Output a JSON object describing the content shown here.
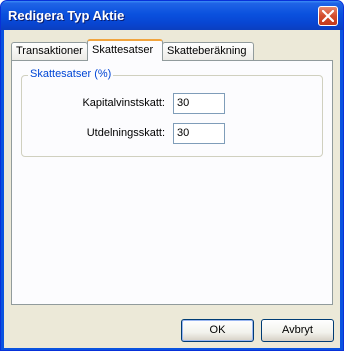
{
  "window": {
    "title": "Redigera Typ Aktie"
  },
  "tabs": [
    {
      "label": "Transaktioner",
      "active": false
    },
    {
      "label": "Skattesatser",
      "active": true
    },
    {
      "label": "Skatteberäkning",
      "active": false
    }
  ],
  "group": {
    "legend": "Skattesatser (%)",
    "fields": [
      {
        "label": "Kapitalvinstskatt:",
        "value": "30"
      },
      {
        "label": "Utdelningsskatt:",
        "value": "30"
      }
    ]
  },
  "buttons": {
    "ok": "OK",
    "cancel": "Avbryt"
  },
  "colors": {
    "titlebar": "#0a51de",
    "client": "#ece9d8",
    "legend": "#0046d5",
    "active_tab_highlight": "#f1a43e"
  },
  "icons": {
    "close": "close-icon"
  }
}
